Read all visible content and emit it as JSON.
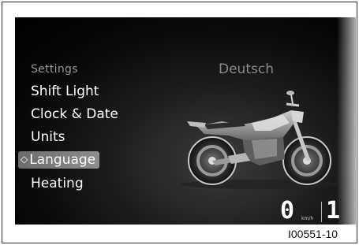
{
  "menu": {
    "heading": "Settings",
    "items": [
      {
        "label": "Shift Light",
        "selected": false
      },
      {
        "label": "Clock & Date",
        "selected": false
      },
      {
        "label": "Units",
        "selected": false
      },
      {
        "label": "Language",
        "selected": true
      },
      {
        "label": "Heating",
        "selected": false
      }
    ],
    "selection_marker": "◇"
  },
  "detail": {
    "value": "Deutsch"
  },
  "status": {
    "speed": "0",
    "speed_unit": "km/h",
    "gear": "1"
  },
  "figure_id": "I00551-10",
  "colors": {
    "screen_background": "#000000",
    "selection_highlight": "#8e8e8e",
    "heading_text": "#9a9a9a",
    "value_text": "#8a8a8a"
  }
}
